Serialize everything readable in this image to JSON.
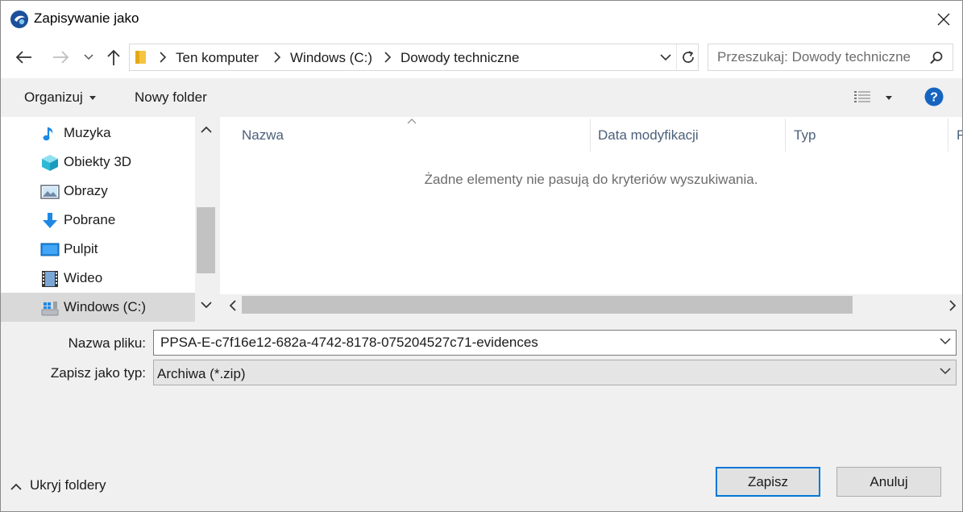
{
  "window": {
    "title": "Zapisywanie jako"
  },
  "address_bar": {
    "crumbs": [
      "Ten komputer",
      "Windows (C:)",
      "Dowody techniczne"
    ]
  },
  "search": {
    "placeholder": "Przeszukaj: Dowody techniczne"
  },
  "toolbar": {
    "organize_label": "Organizuj",
    "new_folder_label": "Nowy folder"
  },
  "nav_pane": {
    "items": [
      {
        "label": "Muzyka",
        "icon": "music-icon"
      },
      {
        "label": "Obiekty 3D",
        "icon": "3d-objects-icon"
      },
      {
        "label": "Obrazy",
        "icon": "pictures-icon"
      },
      {
        "label": "Pobrane",
        "icon": "downloads-icon"
      },
      {
        "label": "Pulpit",
        "icon": "desktop-icon"
      },
      {
        "label": "Wideo",
        "icon": "videos-icon"
      },
      {
        "label": "Windows (C:)",
        "icon": "drive-icon",
        "selected": true
      }
    ]
  },
  "content": {
    "columns": [
      "Nazwa",
      "Data modyfikacji",
      "Typ",
      "R"
    ],
    "empty_message": "Żadne elementy nie pasują do kryteriów wyszukiwania."
  },
  "form": {
    "filename_label": "Nazwa pliku:",
    "filename_value": "PPSA-E-c7f16e12-682a-4742-8178-075204527c71-evidences",
    "filetype_label": "Zapisz jako typ:",
    "filetype_value": "Archiwa (*.zip)"
  },
  "footer": {
    "hide_folders_label": "Ukryj foldery",
    "save_label": "Zapisz",
    "cancel_label": "Anuluj"
  },
  "colors": {
    "accent": "#0078d7",
    "help": "#1565c0",
    "column_header_text": "#4c607a"
  }
}
